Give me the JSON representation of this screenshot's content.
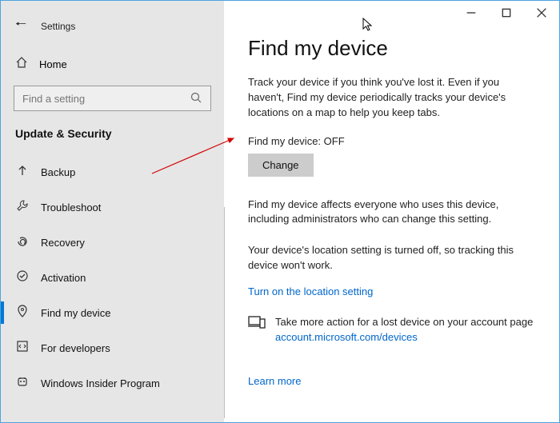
{
  "window": {
    "title": "Settings"
  },
  "sidebar": {
    "home": "Home",
    "search_placeholder": "Find a setting",
    "section": "Update & Security",
    "items": [
      {
        "label": "Backup"
      },
      {
        "label": "Troubleshoot"
      },
      {
        "label": "Recovery"
      },
      {
        "label": "Activation"
      },
      {
        "label": "Find my device"
      },
      {
        "label": "For developers"
      },
      {
        "label": "Windows Insider Program"
      }
    ]
  },
  "main": {
    "title": "Find my device",
    "intro": "Track your device if you think you've lost it. Even if you haven't, Find my device periodically tracks your device's locations on a map to help you keep tabs.",
    "status": "Find my device: OFF",
    "change_button": "Change",
    "affects": "Find my device affects everyone who uses this device, including administrators who can change this setting.",
    "location_off": "Your device's location setting is turned off, so tracking this device won't work.",
    "turn_on_link": "Turn on the location setting",
    "more_action": "Take more action for a lost device on your account page",
    "account_link": "account.microsoft.com/devices",
    "learn_more": "Learn more"
  }
}
